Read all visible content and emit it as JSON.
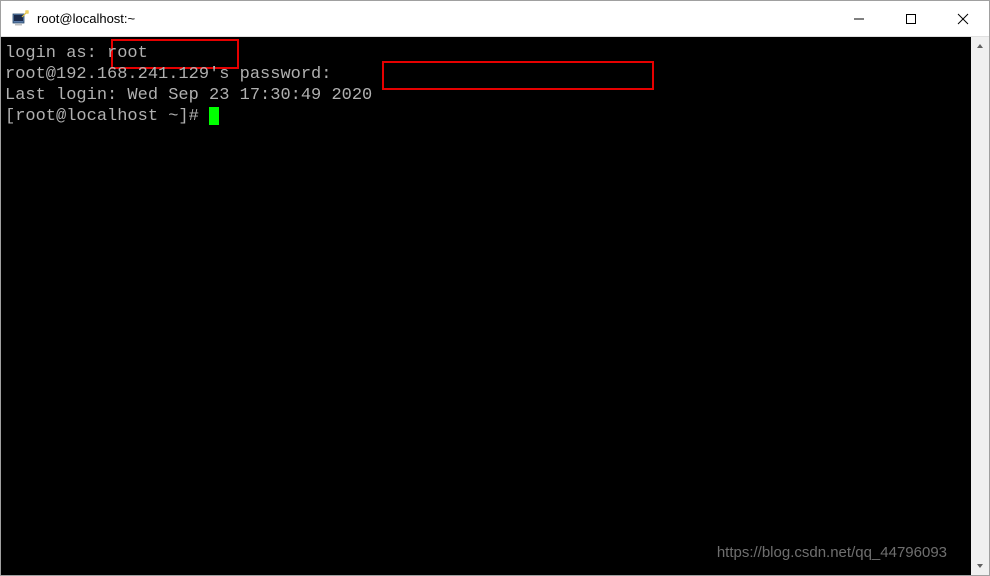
{
  "window": {
    "title": "root@localhost:~"
  },
  "terminal": {
    "line1_prefix": "login as:",
    "line1_input": " root",
    "line2": "root@192.168.241.129's password:",
    "line3": "Last login: Wed Sep 23 17:30:49 2020",
    "line4_prompt": "[root@localhost ~]# "
  },
  "watermark": "https://blog.csdn.net/qq_44796093"
}
